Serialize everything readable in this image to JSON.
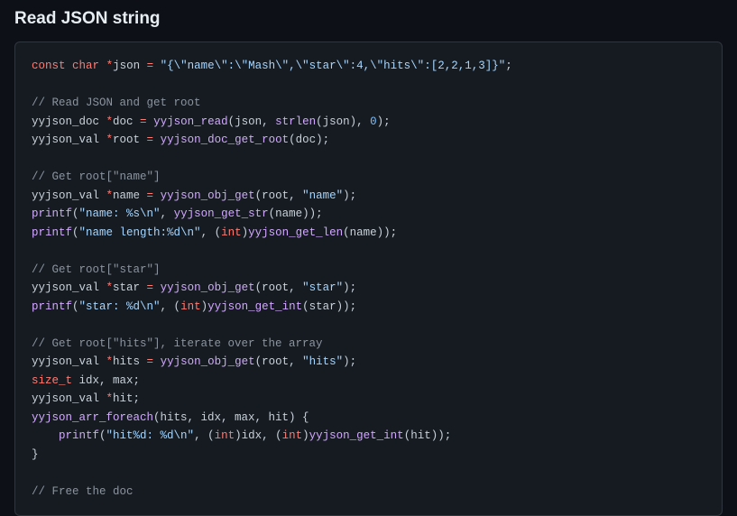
{
  "heading": "Read JSON string",
  "code": {
    "l1": {
      "kw1": "const",
      "kw2": "char",
      "op": "*",
      "id": "json",
      "eq": "=",
      "str": "\"{\\\"name\\\":\\\"Mash\\\",\\\"star\\\":4,\\\"hits\\\":[2,2,1,3]}\"",
      "semi": ";"
    },
    "l3": {
      "cmt": "// Read JSON and get root"
    },
    "l4": {
      "t1": "yyjson_doc ",
      "op": "*",
      "id": "doc ",
      "eq": "= ",
      "fn": "yyjson_read",
      "args_open": "(json, ",
      "fn2": "strlen",
      "args2": "(json), ",
      "num": "0",
      "close": ");"
    },
    "l5": {
      "t1": "yyjson_val ",
      "op": "*",
      "id": "root ",
      "eq": "= ",
      "fn": "yyjson_doc_get_root",
      "args": "(doc);"
    },
    "l7": {
      "cmt": "// Get root[\"name\"]"
    },
    "l8": {
      "t1": "yyjson_val ",
      "op": "*",
      "id": "name ",
      "eq": "= ",
      "fn": "yyjson_obj_get",
      "open": "(root, ",
      "str": "\"name\"",
      "close": ");"
    },
    "l9": {
      "fn": "printf",
      "open": "(",
      "str": "\"name: %s\\n\"",
      "mid": ", ",
      "fn2": "yyjson_get_str",
      "args": "(name));"
    },
    "l10": {
      "fn": "printf",
      "open": "(",
      "str": "\"name length:%d\\n\"",
      "mid": ", (",
      "kw": "int",
      "close1": ")",
      "fn2": "yyjson_get_len",
      "args": "(name));"
    },
    "l12": {
      "cmt": "// Get root[\"star\"]"
    },
    "l13": {
      "t1": "yyjson_val ",
      "op": "*",
      "id": "star ",
      "eq": "= ",
      "fn": "yyjson_obj_get",
      "open": "(root, ",
      "str": "\"star\"",
      "close": ");"
    },
    "l14": {
      "fn": "printf",
      "open": "(",
      "str": "\"star: %d\\n\"",
      "mid": ", (",
      "kw": "int",
      "close1": ")",
      "fn2": "yyjson_get_int",
      "args": "(star));"
    },
    "l16": {
      "cmt": "// Get root[\"hits\"], iterate over the array"
    },
    "l17": {
      "t1": "yyjson_val ",
      "op": "*",
      "id": "hits ",
      "eq": "= ",
      "fn": "yyjson_obj_get",
      "open": "(root, ",
      "str": "\"hits\"",
      "close": ");"
    },
    "l18": {
      "kw": "size_t",
      "rest": " idx, max;"
    },
    "l19": {
      "t1": "yyjson_val ",
      "op": "*",
      "id": "hit;",
      "rest": ""
    },
    "l20": {
      "fn": "yyjson_arr_foreach",
      "args": "(hits, idx, max, hit) {"
    },
    "l21": {
      "indent": "    ",
      "fn": "printf",
      "open": "(",
      "str": "\"hit%d: %d\\n\"",
      "mid": ", (",
      "kw1": "int",
      "close1": ")idx, (",
      "kw2": "int",
      "close2": ")",
      "fn2": "yyjson_get_int",
      "args": "(hit));"
    },
    "l22": {
      "brace": "}"
    },
    "l24": {
      "cmt": "// Free the doc"
    }
  }
}
